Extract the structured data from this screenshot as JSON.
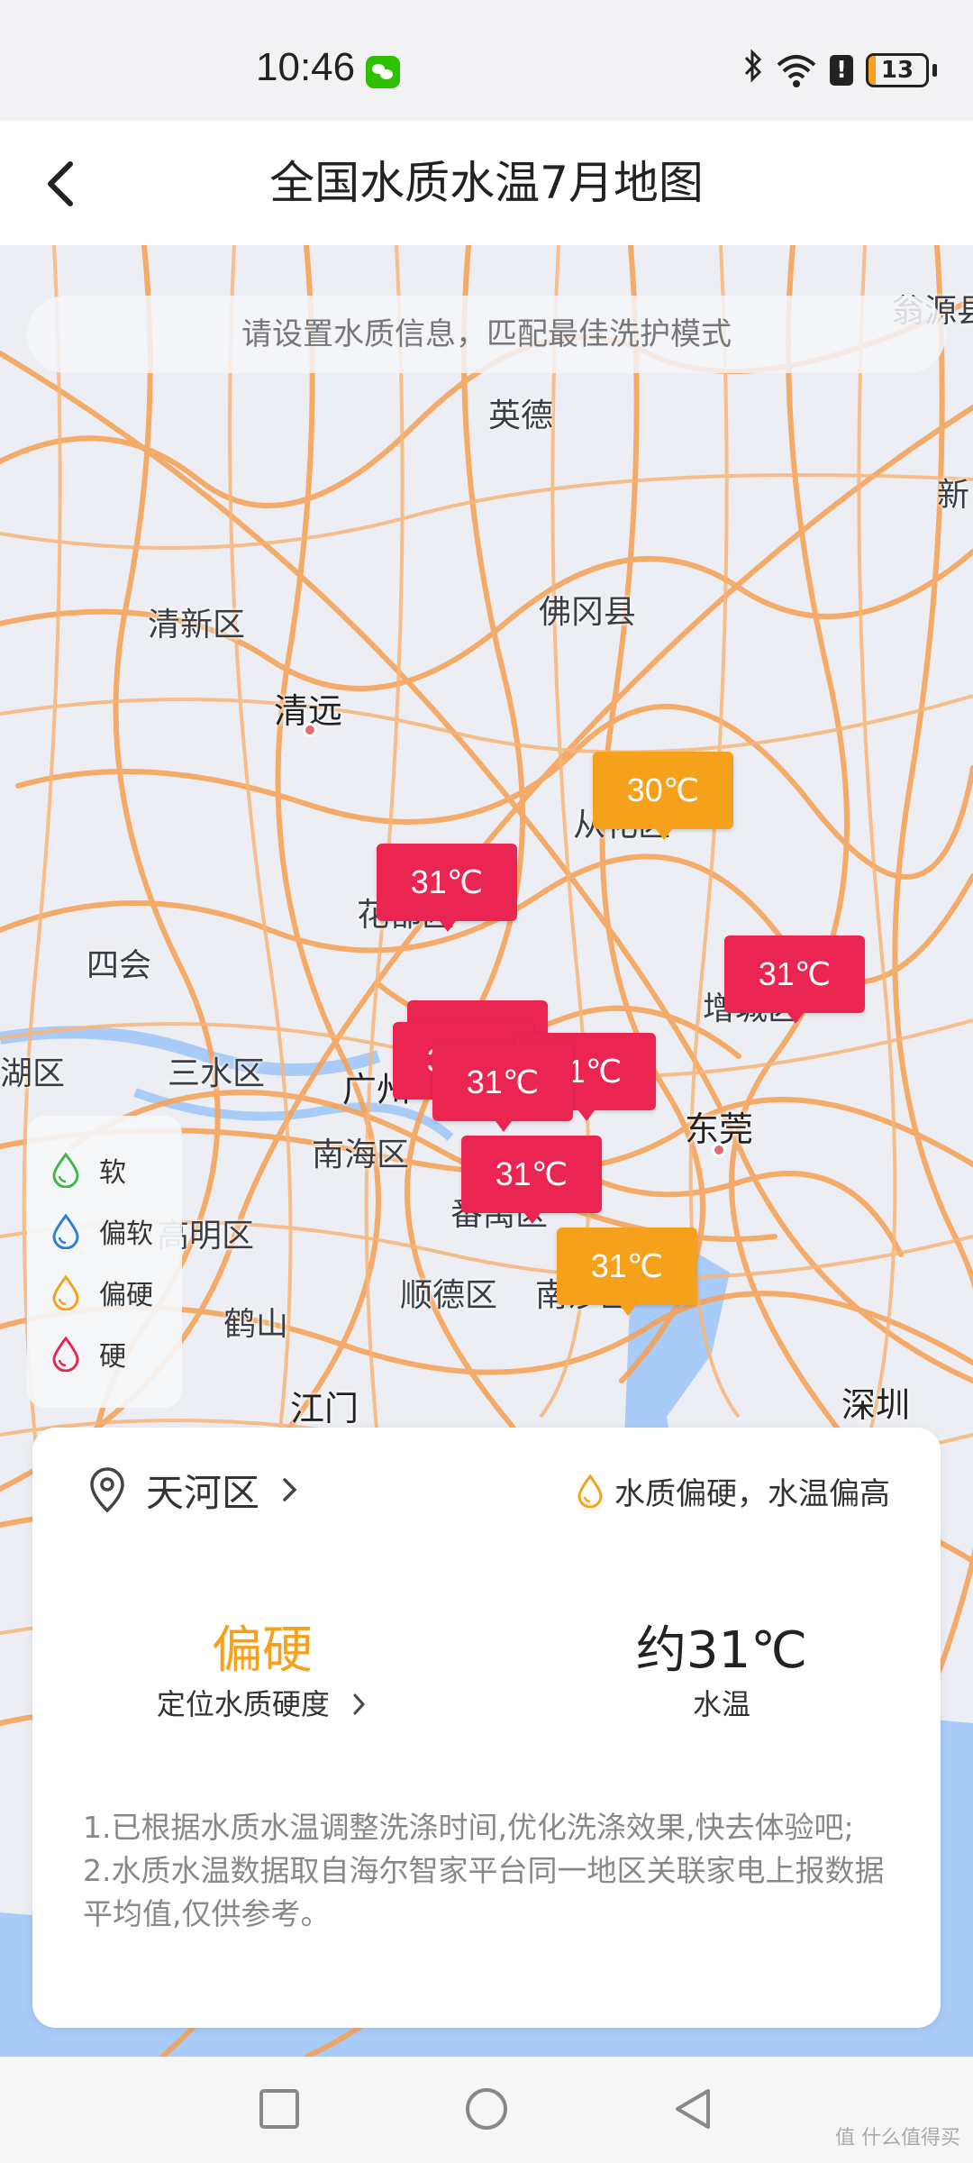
{
  "status_bar": {
    "time": "10:46",
    "battery_level": "13",
    "battery_fraction": 0.13,
    "icons": [
      "wechat-icon",
      "bluetooth-icon",
      "wifi-icon",
      "alert-icon",
      "battery-icon"
    ]
  },
  "header": {
    "title": "全国水质水温7月地图",
    "back_icon": "chevron-left-icon"
  },
  "map": {
    "search_banner": "请设置水质信息，匹配最佳洗护模式",
    "places": {
      "wengyuan": "翁源县",
      "yingde": "英德",
      "xinfeng": "新",
      "qingxin": "清新区",
      "fogang": "佛冈县",
      "qingyuan": "清远",
      "conghua": "从化区",
      "huadu": "花都区",
      "sihui": "四会",
      "zengcheng": "增城区",
      "dinghu": "鼎湖区",
      "sanshui": "三水区",
      "guangzhou": "广州",
      "dongguan": "东莞",
      "nanhai": "南海区",
      "panyu": "番禺区",
      "gaoming": "高明区",
      "shunde": "顺德区",
      "nansha": "南沙区",
      "heshan": "鹤山",
      "jiangmen": "江门",
      "shenzhen": "深圳"
    },
    "legend": [
      {
        "label": "软",
        "color": "#3fb54c",
        "icon": "drop-icon"
      },
      {
        "label": "偏软",
        "color": "#2f7fd6",
        "icon": "drop-icon"
      },
      {
        "label": "偏硬",
        "color": "#f5a11c",
        "icon": "drop-icon"
      },
      {
        "label": "硬",
        "color": "#ea2551",
        "icon": "drop-icon"
      }
    ],
    "markers": [
      {
        "label": "30℃",
        "level": "偏硬"
      },
      {
        "label": "31℃",
        "level": "硬"
      },
      {
        "label": "31℃",
        "level": "硬"
      },
      {
        "label": "31℃",
        "level": "硬"
      },
      {
        "label": "31℃",
        "level": "硬"
      },
      {
        "label": "31℃",
        "level": "硬"
      },
      {
        "label": "31℃",
        "level": "硬"
      },
      {
        "label": "31℃",
        "level": "硬"
      },
      {
        "label": "31℃",
        "level": "偏硬"
      }
    ]
  },
  "card": {
    "district": "天河区",
    "quality_status": "水质偏硬，水温偏高",
    "hardness_value": "偏硬",
    "hardness_link": "定位水质硬度",
    "temp_value": "约31℃",
    "temp_label": "水温",
    "notes": [
      "1.已根据水质水温调整洗涤时间,优化洗涤效果,快去体验吧;",
      "2.水质水温数据取自海尔智家平台同一地区关联家电上报数据平均值,仅供参考。"
    ]
  },
  "nav": {
    "recent_icon": "square-icon",
    "home_icon": "circle-icon",
    "back_icon": "triangle-back-icon"
  },
  "colors": {
    "hard": "#ea2551",
    "slightly_hard": "#f5a11c",
    "road": "#f5a35a"
  },
  "watermark": "值 什么值得买"
}
